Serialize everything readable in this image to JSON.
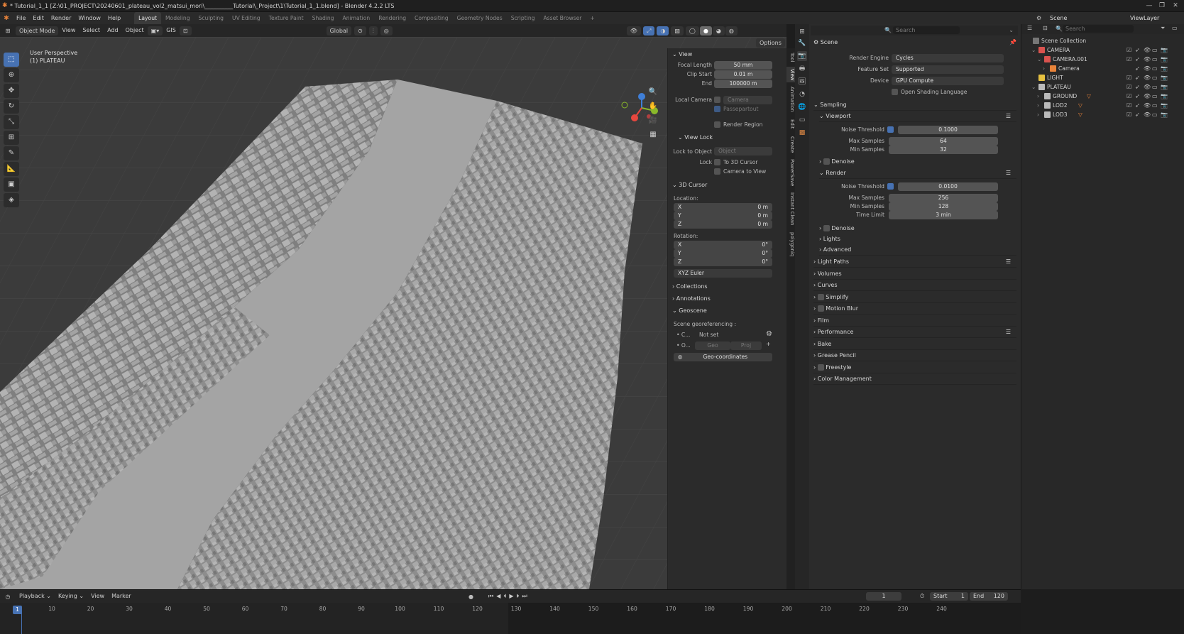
{
  "window": {
    "title": "* Tutorial_1_1 [Z:\\01_PROJECT\\20240601_plateau_vol2_matsui_mori\\__________Tutorial\\_Project\\1\\Tutorial_1_1.blend] - Blender 4.2.2 LTS"
  },
  "menu": [
    "File",
    "Edit",
    "Render",
    "Window",
    "Help"
  ],
  "workspaces": [
    "Layout",
    "Modeling",
    "Sculpting",
    "UV Editing",
    "Texture Paint",
    "Shading",
    "Animation",
    "Rendering",
    "Compositing",
    "Geometry Nodes",
    "Scripting",
    "Asset Browser"
  ],
  "top_right": {
    "scene": "Scene",
    "view_layer": "ViewLayer"
  },
  "viewport_header": {
    "mode": "Object Mode",
    "items": [
      "View",
      "Select",
      "Add",
      "Object"
    ],
    "gis": "GIS",
    "transform": "Global",
    "options": "Options"
  },
  "viewport": {
    "perspective": "User Perspective",
    "object": "(1) PLATEAU"
  },
  "npanel": {
    "view_section": "View",
    "focal_length_label": "Focal Length",
    "focal_length": "50 mm",
    "clip_start_label": "Clip Start",
    "clip_start": "0.01 m",
    "end_label": "End",
    "end": "100000 m",
    "local_camera_label": "Local Camera",
    "local_camera_placeholder": "Camera",
    "passepartout": "Passepartout",
    "render_region": "Render Region",
    "view_lock_section": "View Lock",
    "lock_to_object_label": "Lock to Object",
    "lock_object_placeholder": "Object",
    "lock_label": "Lock",
    "to_3d_cursor": "To 3D Cursor",
    "camera_to_view": "Camera to View",
    "cursor_section": "3D Cursor",
    "location_label": "Location:",
    "loc_x_label": "X",
    "loc_x": "0 m",
    "loc_y_label": "Y",
    "loc_y": "0 m",
    "loc_z_label": "Z",
    "loc_z": "0 m",
    "rotation_label": "Rotation:",
    "rot_x_label": "X",
    "rot_x": "0°",
    "rot_y_label": "Y",
    "rot_y": "0°",
    "rot_z_label": "Z",
    "rot_z": "0°",
    "rotation_mode": "XYZ Euler",
    "collections": "Collections",
    "annotations": "Annotations",
    "geoscene": "Geoscene",
    "georef_label": "Scene georeferencing :",
    "crs_short": "C...",
    "crs_value": "Not set",
    "origin_short": "O...",
    "geo_btn": "Geo",
    "proj_btn": "Proj",
    "geo_coordinates": "Geo-coordinates"
  },
  "sidebar_tabs": [
    "Tool",
    "View",
    "Animation",
    "Edit",
    "Create",
    "PowerSave",
    "Instant Clean",
    "polygoniq"
  ],
  "properties": {
    "scene_label": "Scene",
    "search_placeholder": "Search",
    "render_engine_label": "Render Engine",
    "render_engine": "Cycles",
    "feature_set_label": "Feature Set",
    "feature_set": "Supported",
    "device_label": "Device",
    "device": "GPU Compute",
    "osl": "Open Shading Language",
    "sampling": "Sampling",
    "viewport": "Viewport",
    "vp_noise_label": "Noise Threshold",
    "vp_noise": "0.1000",
    "vp_max_label": "Max Samples",
    "vp_max": "64",
    "vp_min_label": "Min Samples",
    "vp_min": "32",
    "denoise": "Denoise",
    "render": "Render",
    "r_noise_label": "Noise Threshold",
    "r_noise": "0.0100",
    "r_max_label": "Max Samples",
    "r_max": "256",
    "r_min_label": "Min Samples",
    "r_min": "128",
    "r_time_label": "Time Limit",
    "r_time": "3 min",
    "denoise2": "Denoise",
    "lights": "Lights",
    "advanced": "Advanced",
    "panels": [
      "Light Paths",
      "Volumes",
      "Curves",
      "Simplify",
      "Motion Blur",
      "Film",
      "Performance",
      "Bake",
      "Grease Pencil",
      "Freestyle",
      "Color Management"
    ]
  },
  "outliner": {
    "search_placeholder": "Search",
    "rows": [
      {
        "name": "Scene Collection",
        "kind": "scene"
      },
      {
        "name": "CAMERA",
        "kind": "collection"
      },
      {
        "name": "CAMERA.001",
        "kind": "camera-obj"
      },
      {
        "name": "Camera",
        "kind": "camera-data"
      },
      {
        "name": "LIGHT",
        "kind": "collection-yellow"
      },
      {
        "name": "PLATEAU",
        "kind": "collection"
      },
      {
        "name": "GROUND",
        "kind": "mesh"
      },
      {
        "name": "LOD2",
        "kind": "mesh"
      },
      {
        "name": "LOD3",
        "kind": "mesh"
      }
    ]
  },
  "timeline": {
    "menus": [
      "Playback",
      "Keying",
      "View",
      "Marker"
    ],
    "current_frame": "1",
    "start_label": "Start",
    "start": "1",
    "end_label": "End",
    "end": "120",
    "ticks": [
      "10",
      "20",
      "30",
      "40",
      "50",
      "60",
      "70",
      "80",
      "90",
      "100",
      "110",
      "120",
      "130",
      "140",
      "150",
      "160",
      "170",
      "180",
      "190",
      "200",
      "210",
      "220",
      "230",
      "240"
    ],
    "cursor_frame": "1"
  },
  "colors": {
    "accent": "#4772b3",
    "orange": "#e8833a",
    "gizmo_x": "#e8473e",
    "gizmo_y": "#8ab82a",
    "gizmo_z": "#3f7fd8"
  }
}
